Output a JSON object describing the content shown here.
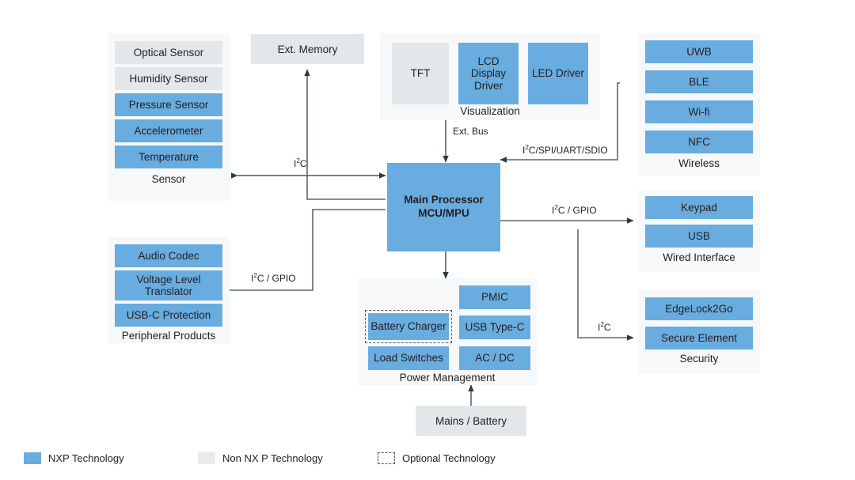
{
  "legend": {
    "items": [
      {
        "label": "NXP Technology",
        "swatch": "nxp",
        "color": "#69ace0"
      },
      {
        "label": "Non NX P Technology",
        "swatch": "nonnxp",
        "color": "#e8ebed"
      },
      {
        "label": "Optional Technology",
        "swatch": "optional",
        "color": "#ffffff"
      }
    ]
  },
  "processor": {
    "line1": "Main Processor",
    "line2": "MCU/MPU"
  },
  "groups": {
    "sensor": {
      "label": "Sensor",
      "blocks": [
        {
          "label": "Optical Sensor",
          "kind": "nonnxp"
        },
        {
          "label": "Humidity Sensor",
          "kind": "nonnxp"
        },
        {
          "label": "Pressure Sensor",
          "kind": "nxp"
        },
        {
          "label": "Accelerometer",
          "kind": "nxp"
        },
        {
          "label": "Temperature",
          "kind": "nxp"
        }
      ]
    },
    "peripheral": {
      "label": "Peripheral Products",
      "blocks": [
        {
          "label": "Audio Codec",
          "kind": "nxp"
        },
        {
          "label": "Voltage Level Translator",
          "kind": "nxp"
        },
        {
          "label": "USB-C Protection",
          "kind": "nxp"
        }
      ]
    },
    "visualization": {
      "label": "Visualization",
      "blocks": [
        {
          "label": "TFT",
          "kind": "nonnxp"
        },
        {
          "label": "LCD Display Driver",
          "kind": "nxp"
        },
        {
          "label": "LED Driver",
          "kind": "nxp"
        }
      ]
    },
    "wireless": {
      "label": "Wireless",
      "blocks": [
        {
          "label": "UWB",
          "kind": "nxp"
        },
        {
          "label": "BLE",
          "kind": "nxp"
        },
        {
          "label": "Wi-fi",
          "kind": "nxp"
        },
        {
          "label": "NFC",
          "kind": "nxp"
        }
      ]
    },
    "wired": {
      "label": "Wired Interface",
      "blocks": [
        {
          "label": "Keypad",
          "kind": "nxp"
        },
        {
          "label": "USB",
          "kind": "nxp"
        }
      ]
    },
    "security": {
      "label": "Security",
      "blocks": [
        {
          "label": "EdgeLock2Go",
          "kind": "nxp"
        },
        {
          "label": "Secure Element",
          "kind": "nxp"
        }
      ]
    },
    "power": {
      "label": "Power Management",
      "blocks": [
        {
          "label": "Battery Charger",
          "kind": "optional"
        },
        {
          "label": "Load Switches",
          "kind": "nxp"
        },
        {
          "label": "PMIC",
          "kind": "nxp"
        },
        {
          "label": "USB Type-C",
          "kind": "nxp"
        },
        {
          "label": "AC / DC",
          "kind": "nxp"
        }
      ]
    }
  },
  "standalone": {
    "ext_memory": "Ext. Memory",
    "mains_battery": "Mains / Battery"
  },
  "connections": {
    "sensor_bus": "I²C",
    "peripheral_bus": "I²C / GPIO",
    "ext_bus": "Ext. Bus",
    "wireless_bus": "I²C/SPI/UART/SDIO",
    "wired_bus": "I²C / GPIO",
    "security_bus": "I²C"
  }
}
